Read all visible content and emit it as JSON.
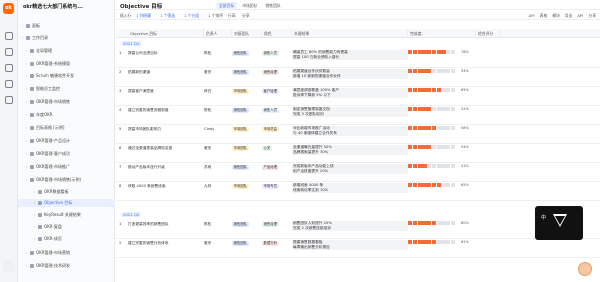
{
  "app": {
    "logo_text": "ok",
    "workspace_title": "okr精选七大部门系统与...",
    "page_title": "Objective 目标"
  },
  "sidebar": {
    "nav": [
      {
        "label": "面板",
        "active": false
      },
      {
        "label": "工作目录",
        "active": false
      },
      {
        "label": "全局管理",
        "active": false
      },
      {
        "label": "OKR管理-系统模版",
        "active": false
      },
      {
        "label": "Scrum 敏捷软件开发",
        "active": false
      },
      {
        "label": "智能员工监控",
        "active": false
      },
      {
        "label": "OKR管理-市场销售",
        "active": false
      },
      {
        "label": "年度OKR",
        "active": false
      },
      {
        "label": "目标表格 [示例]",
        "active": false
      },
      {
        "label": "OKR管理-产品设计",
        "active": false
      },
      {
        "label": "OKR管理-客户成功",
        "active": false
      },
      {
        "label": "OKR管理-市场推广",
        "active": false
      },
      {
        "label": "OKR管理-市场销售(示例)",
        "active": false
      },
      {
        "label": "OKR数据看板",
        "active": false
      },
      {
        "label": "Objective 目标",
        "active": true
      },
      {
        "label": "KeyResult 关键结果",
        "active": false
      },
      {
        "label": "OKR-复盘",
        "active": false
      },
      {
        "label": "OKR-成员",
        "active": false
      },
      {
        "label": "OKR管理-市场营销",
        "active": false
      },
      {
        "label": "OKR管理-技术研发",
        "active": false
      }
    ]
  },
  "tabs": [
    {
      "label": "全部目标",
      "active": true
    },
    {
      "label": "市场团队",
      "active": false
    },
    {
      "label": "销售团队",
      "active": false
    }
  ],
  "toolbar": {
    "items": [
      "插入行",
      "1 列隐藏",
      "1 个筛选",
      "1 个分组",
      "1 个排序",
      "行高",
      "分享"
    ],
    "right": [
      "API",
      "表格",
      "模块",
      "导出",
      "API",
      "分享"
    ]
  },
  "columns": [
    "Objective 目标",
    "负责人",
    "对接团队",
    "角色",
    "关键结果",
    "完成度",
    "综合评分"
  ],
  "groups": [
    {
      "label": "2021 Q1",
      "rows": [
        {
          "no": "1",
          "obj": "提高公司业绩目标",
          "owner": "陈松",
          "team": "销售团队",
          "role": "销售人员",
          "krs": [
            "确保员工 80% 的销售能力有提高",
            "提高 100 万新业绩收入增长"
          ],
          "progress": 78
        },
        {
          "no": "2",
          "obj": "拓展新的渠道",
          "owner": "夏安",
          "team": "销售团队",
          "role": "销售经理",
          "krs": [
            "拓展渠道合作伙伴数量",
            "新增 10 家新的渠道合作伙伴"
          ],
          "progress": 54
        },
        {
          "no": "3",
          "obj": "提高客户满意度",
          "owner": "林白",
          "team": "市场团队",
          "role": "客户经理",
          "krs": [
            "满意度调查覆盖 100% 客户",
            "投诉率下降到 5% 以下"
          ],
          "progress": 65
        },
        {
          "no": "4",
          "obj": "建立完善的销售流程制度",
          "owner": "陈松",
          "team": "销售团队",
          "role": "销售人员",
          "krs": [
            "制定销售管理制度文档",
            "完成 3 次团队培训"
          ],
          "progress": 52
        },
        {
          "no": "5",
          "obj": "提高市场团队影响力",
          "owner": "Cindy",
          "team": "市场团队",
          "role": "市场总监",
          "krs": [
            "对比新增市场推广活动",
            "与 40 家媒体建立合作关系"
          ],
          "progress": 58
        },
        {
          "no": "6",
          "obj": "通过全渠道提高品牌知名度",
          "owner": "夏安",
          "team": "市场团队",
          "role": "公关",
          "krs": [
            "全渠道曝光量提升 50%",
            "品牌搜索量提升 30%"
          ],
          "progress": 54
        },
        {
          "no": "7",
          "obj": "推动产品版本迭代升级",
          "owner": "苏雨",
          "team": "销售团队",
          "role": "产品经理",
          "krs": [
            "完成新版本产品功能上线",
            "用户活跃度提升 20%"
          ],
          "progress": 41
        },
        {
          "no": "8",
          "obj": "获取 4000 条销售线索",
          "owner": "九林",
          "team": "市场团队",
          "role": "市场专员",
          "krs": [
            "新增线索 4000 条",
            "线索转化率达到 10%"
          ],
          "progress": 65
        }
      ]
    },
    {
      "label": "2021 Q2",
      "rows": [
        {
          "no": "1",
          "obj": "打造更高效率的销售团队",
          "owner": "陈松",
          "team": "销售团队",
          "role": "销售经理",
          "krs": [
            "销售团队人效提升 20%",
            "完成 2 次销售技能培训"
          ],
          "progress": 60
        },
        {
          "no": "2",
          "obj": "建立完善的销售分析体系",
          "owner": "夏安",
          "team": "销售团队",
          "role": "数据分析",
          "krs": [
            "搭建销售数据看板",
            "每周输出销售分析报告"
          ],
          "progress": 62
        }
      ]
    }
  ],
  "preview": {
    "label": "中"
  },
  "colors": {
    "accent": "#3b6cf0",
    "progress": "#f26b3a",
    "sales_tag": "#dfe8ff",
    "market_tag": "#fff0c9"
  }
}
